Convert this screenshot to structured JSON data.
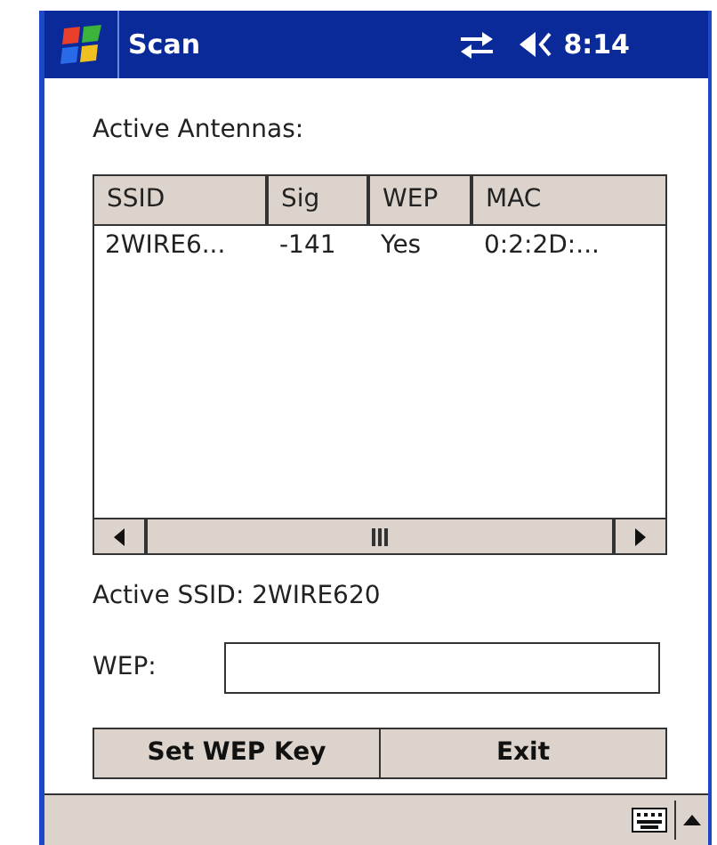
{
  "title_bar": {
    "title": "Scan",
    "time": "8:14"
  },
  "list_label": "Active Antennas:",
  "table": {
    "columns": [
      "SSID",
      "Sig",
      "WEP",
      "MAC"
    ],
    "rows": [
      [
        "2WIRE6...",
        "-141",
        "Yes",
        "0:2:2D:..."
      ]
    ]
  },
  "active_ssid": "Active SSID: 2WIRE620",
  "wep_field": {
    "label": "WEP:"
  },
  "buttons": [
    "Set WEP Key",
    "Exit"
  ]
}
